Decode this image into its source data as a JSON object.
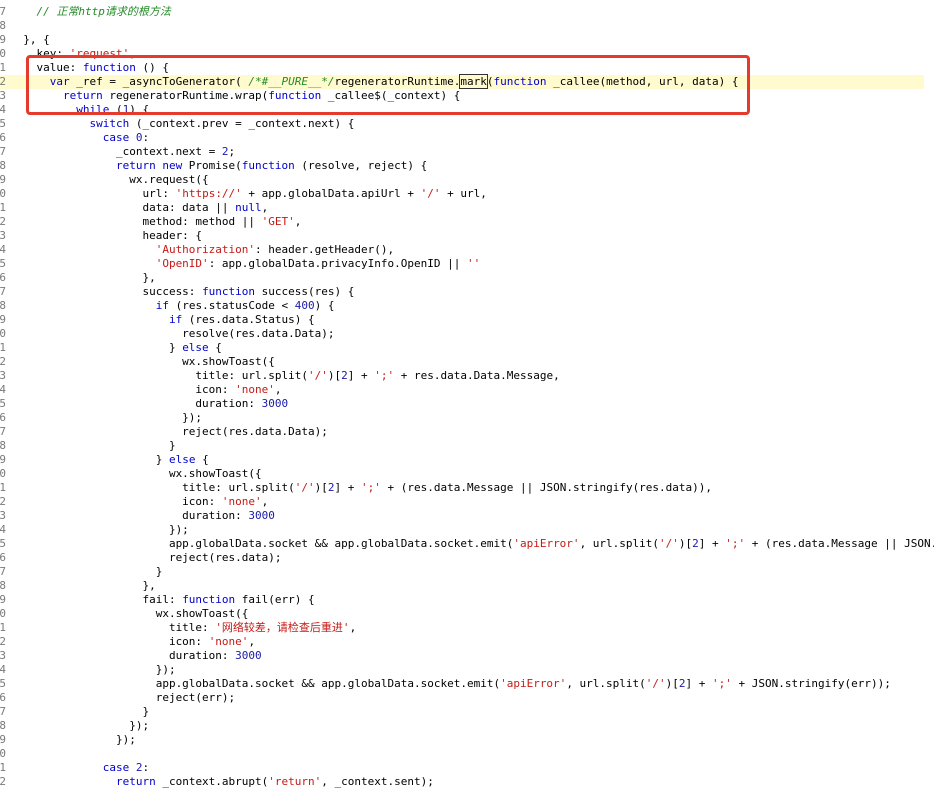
{
  "editor": {
    "lines": [
      {
        "n": "7",
        "segs": [
          [
            "c-comment",
            "    // 正常http请求的根方法"
          ]
        ]
      },
      {
        "n": "8",
        "segs": []
      },
      {
        "n": "9",
        "segs": [
          [
            "",
            "  }, {"
          ]
        ]
      },
      {
        "n": "0",
        "segs": [
          [
            "",
            "    key: "
          ],
          [
            "c-str",
            "'request'"
          ],
          [
            "",
            ","
          ]
        ]
      },
      {
        "n": "1",
        "segs": [
          [
            "",
            "    value: "
          ],
          [
            "c-kw",
            "function"
          ],
          [
            "",
            " () {"
          ]
        ]
      },
      {
        "n": "2",
        "segs": [
          [
            "c-kw",
            "      var"
          ],
          [
            "",
            " _ref = _asyncToGenerator( "
          ],
          [
            "c-comment",
            "/*#__PURE__*/"
          ],
          [
            "",
            "regeneratorRuntime."
          ],
          [
            "sel",
            "mark"
          ],
          [
            "",
            "("
          ],
          [
            "c-kw",
            "function"
          ],
          [
            "",
            " _callee(method, url, data) {"
          ]
        ]
      },
      {
        "n": "3",
        "segs": [
          [
            "c-kw",
            "        return"
          ],
          [
            "",
            " regeneratorRuntime.wrap("
          ],
          [
            "c-kw",
            "function"
          ],
          [
            "",
            " _callee$(_context) {"
          ]
        ]
      },
      {
        "n": "4",
        "segs": [
          [
            "c-kw",
            "          while"
          ],
          [
            "",
            " ("
          ],
          [
            "c-num",
            "1"
          ],
          [
            "",
            ") {"
          ]
        ]
      },
      {
        "n": "5",
        "segs": [
          [
            "c-kw",
            "            switch"
          ],
          [
            "",
            " (_context.prev = _context.next) {"
          ]
        ]
      },
      {
        "n": "6",
        "segs": [
          [
            "c-kw",
            "              case"
          ],
          [
            "",
            " "
          ],
          [
            "c-num",
            "0"
          ],
          [
            "",
            ":"
          ]
        ]
      },
      {
        "n": "7",
        "segs": [
          [
            "",
            "                _context.next = "
          ],
          [
            "c-num",
            "2"
          ],
          [
            "",
            ";"
          ]
        ]
      },
      {
        "n": "8",
        "segs": [
          [
            "c-kw",
            "                return new"
          ],
          [
            "",
            " Promise("
          ],
          [
            "c-kw",
            "function"
          ],
          [
            "",
            " (resolve, reject) {"
          ]
        ]
      },
      {
        "n": "9",
        "segs": [
          [
            "",
            "                  wx.request({"
          ]
        ]
      },
      {
        "n": "0",
        "segs": [
          [
            "",
            "                    url: "
          ],
          [
            "c-str",
            "'https://'"
          ],
          [
            "",
            " + app.globalData.apiUrl + "
          ],
          [
            "c-str",
            "'/'"
          ],
          [
            "",
            " + url,"
          ]
        ]
      },
      {
        "n": "1",
        "segs": [
          [
            "",
            "                    data: data || "
          ],
          [
            "c-kw",
            "null"
          ],
          [
            "",
            ","
          ]
        ]
      },
      {
        "n": "2",
        "segs": [
          [
            "",
            "                    method: method || "
          ],
          [
            "c-str",
            "'GET'"
          ],
          [
            "",
            ","
          ]
        ]
      },
      {
        "n": "3",
        "segs": [
          [
            "",
            "                    header: {"
          ]
        ]
      },
      {
        "n": "4",
        "segs": [
          [
            "c-str",
            "                      'Authorization'"
          ],
          [
            "",
            ": header.getHeader(),"
          ]
        ]
      },
      {
        "n": "5",
        "segs": [
          [
            "c-str",
            "                      'OpenID'"
          ],
          [
            "",
            ": app.globalData.privacyInfo.OpenID || "
          ],
          [
            "c-str",
            "''"
          ]
        ]
      },
      {
        "n": "6",
        "segs": [
          [
            "",
            "                    },"
          ]
        ]
      },
      {
        "n": "7",
        "segs": [
          [
            "",
            "                    success: "
          ],
          [
            "c-kw",
            "function"
          ],
          [
            "",
            " success(res) {"
          ]
        ]
      },
      {
        "n": "8",
        "segs": [
          [
            "c-kw",
            "                      if"
          ],
          [
            "",
            " (res.statusCode < "
          ],
          [
            "c-num",
            "400"
          ],
          [
            "",
            ") {"
          ]
        ]
      },
      {
        "n": "9",
        "segs": [
          [
            "c-kw",
            "                        if"
          ],
          [
            "",
            " (res.data.Status) {"
          ]
        ]
      },
      {
        "n": "0",
        "segs": [
          [
            "",
            "                          resolve(res.data.Data);"
          ]
        ]
      },
      {
        "n": "1",
        "segs": [
          [
            "",
            "                        } "
          ],
          [
            "c-kw",
            "else"
          ],
          [
            "",
            " {"
          ]
        ]
      },
      {
        "n": "2",
        "segs": [
          [
            "",
            "                          wx.showToast({"
          ]
        ]
      },
      {
        "n": "3",
        "segs": [
          [
            "",
            "                            title: url.split("
          ],
          [
            "c-str",
            "'/'"
          ],
          [
            "",
            ")["
          ],
          [
            "c-num",
            "2"
          ],
          [
            "",
            "] + "
          ],
          [
            "c-str",
            "';'"
          ],
          [
            "",
            " + res.data.Data.Message,"
          ]
        ]
      },
      {
        "n": "4",
        "segs": [
          [
            "",
            "                            icon: "
          ],
          [
            "c-str",
            "'none'"
          ],
          [
            "",
            ","
          ]
        ]
      },
      {
        "n": "5",
        "segs": [
          [
            "",
            "                            duration: "
          ],
          [
            "c-num",
            "3000"
          ]
        ]
      },
      {
        "n": "6",
        "segs": [
          [
            "",
            "                          });"
          ]
        ]
      },
      {
        "n": "7",
        "segs": [
          [
            "",
            "                          reject(res.data.Data);"
          ]
        ]
      },
      {
        "n": "8",
        "segs": [
          [
            "",
            "                        }"
          ]
        ]
      },
      {
        "n": "9",
        "segs": [
          [
            "",
            "                      } "
          ],
          [
            "c-kw",
            "else"
          ],
          [
            "",
            " {"
          ]
        ]
      },
      {
        "n": "0",
        "segs": [
          [
            "",
            "                        wx.showToast({"
          ]
        ]
      },
      {
        "n": "1",
        "segs": [
          [
            "",
            "                          title: url.split("
          ],
          [
            "c-str",
            "'/'"
          ],
          [
            "",
            ")["
          ],
          [
            "c-num",
            "2"
          ],
          [
            "",
            "] + "
          ],
          [
            "c-str",
            "';'"
          ],
          [
            "",
            " + (res.data.Message || JSON.stringify(res.data)),"
          ]
        ]
      },
      {
        "n": "2",
        "segs": [
          [
            "",
            "                          icon: "
          ],
          [
            "c-str",
            "'none'"
          ],
          [
            "",
            ","
          ]
        ]
      },
      {
        "n": "3",
        "segs": [
          [
            "",
            "                          duration: "
          ],
          [
            "c-num",
            "3000"
          ]
        ]
      },
      {
        "n": "4",
        "segs": [
          [
            "",
            "                        });"
          ]
        ]
      },
      {
        "n": "5",
        "segs": [
          [
            "",
            "                        app.globalData.socket && app.globalData.socket.emit("
          ],
          [
            "c-str",
            "'apiError'"
          ],
          [
            "",
            ", url.split("
          ],
          [
            "c-str",
            "'/'"
          ],
          [
            "",
            ")["
          ],
          [
            "c-num",
            "2"
          ],
          [
            "",
            "] + "
          ],
          [
            "c-str",
            "';'"
          ],
          [
            "",
            " + (res.data.Message || JSON."
          ]
        ]
      },
      {
        "n": "6",
        "segs": [
          [
            "",
            "                        reject(res.data);"
          ]
        ]
      },
      {
        "n": "7",
        "segs": [
          [
            "",
            "                      }"
          ]
        ]
      },
      {
        "n": "8",
        "segs": [
          [
            "",
            "                    },"
          ]
        ]
      },
      {
        "n": "9",
        "segs": [
          [
            "",
            "                    fail: "
          ],
          [
            "c-kw",
            "function"
          ],
          [
            "",
            " fail(err) {"
          ]
        ]
      },
      {
        "n": "0",
        "segs": [
          [
            "",
            "                      wx.showToast({"
          ]
        ]
      },
      {
        "n": "1",
        "segs": [
          [
            "",
            "                        title: "
          ],
          [
            "c-str",
            "'网络较差，请检查后重进'"
          ],
          [
            "",
            ","
          ]
        ]
      },
      {
        "n": "2",
        "segs": [
          [
            "",
            "                        icon: "
          ],
          [
            "c-str",
            "'none'"
          ],
          [
            "",
            ","
          ]
        ]
      },
      {
        "n": "3",
        "segs": [
          [
            "",
            "                        duration: "
          ],
          [
            "c-num",
            "3000"
          ]
        ]
      },
      {
        "n": "4",
        "segs": [
          [
            "",
            "                      });"
          ]
        ]
      },
      {
        "n": "5",
        "segs": [
          [
            "",
            "                      app.globalData.socket && app.globalData.socket.emit("
          ],
          [
            "c-str",
            "'apiError'"
          ],
          [
            "",
            ", url.split("
          ],
          [
            "c-str",
            "'/'"
          ],
          [
            "",
            ")["
          ],
          [
            "c-num",
            "2"
          ],
          [
            "",
            "] + "
          ],
          [
            "c-str",
            "';'"
          ],
          [
            "",
            " + JSON.stringify(err));"
          ]
        ]
      },
      {
        "n": "6",
        "segs": [
          [
            "",
            "                      reject(err);"
          ]
        ]
      },
      {
        "n": "7",
        "segs": [
          [
            "",
            "                    }"
          ]
        ]
      },
      {
        "n": "8",
        "segs": [
          [
            "",
            "                  });"
          ]
        ]
      },
      {
        "n": "9",
        "segs": [
          [
            "",
            "                });"
          ]
        ]
      },
      {
        "n": "0",
        "segs": []
      },
      {
        "n": "1",
        "segs": [
          [
            "c-kw",
            "              case"
          ],
          [
            "",
            " "
          ],
          [
            "c-num",
            "2"
          ],
          [
            "",
            ":"
          ]
        ]
      },
      {
        "n": "2",
        "segs": [
          [
            "c-kw",
            "                return"
          ],
          [
            "",
            " _context.abrupt("
          ],
          [
            "c-str",
            "'return'"
          ],
          [
            "",
            ", _context.sent);"
          ]
        ]
      }
    ],
    "highlighted_line": 5,
    "highlight_box_color": "#e53b2c"
  }
}
